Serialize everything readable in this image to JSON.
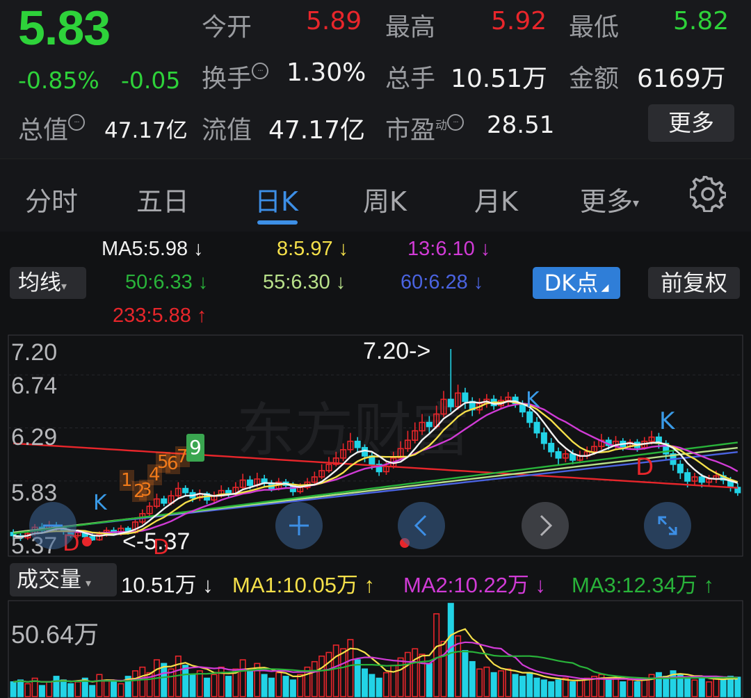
{
  "quote": {
    "price": "5.83",
    "change_pct": "-0.85%",
    "change_abs": "-0.05",
    "open_label": "今开",
    "open_value": "5.89",
    "high_label": "最高",
    "high_value": "5.92",
    "low_label": "最低",
    "low_value": "5.82",
    "turnover_label": "换手",
    "turnover_value": "1.30%",
    "volume_label": "总手",
    "volume_value": "10.51万",
    "amount_label": "金额",
    "amount_value": "6169万",
    "mktcap_label": "总值",
    "mktcap_value": "47.17亿",
    "float_label": "流值",
    "float_value": "47.17亿",
    "pe_label": "市盈",
    "pe_sup": "动",
    "pe_value": "28.51",
    "more_label": "更多",
    "colors": {
      "up": "#e8262b",
      "down": "#2ed23a"
    }
  },
  "tabs": {
    "items": [
      "分时",
      "五日",
      "日K",
      "周K",
      "月K",
      "更多"
    ],
    "active": "日K",
    "settings_icon": "gear-icon"
  },
  "kline_panel": {
    "ma_dropdown": "均线",
    "ma_values": [
      {
        "text": "MA5:5.98 ↓",
        "color": "#f2f2f2"
      },
      {
        "text": "8:5.97 ↓",
        "color": "#f5e04a"
      },
      {
        "text": "13:6.10 ↓",
        "color": "#d13bd6"
      },
      {
        "text": "50:6.33 ↓",
        "color": "#29b33a"
      },
      {
        "text": "55:6.30 ↓",
        "color": "#b8e08a"
      },
      {
        "text": "60:6.28 ↓",
        "color": "#4a63e0"
      },
      {
        "text": "233:5.88 ↑",
        "color": "#e8262b"
      }
    ],
    "dk_button": "DK点",
    "adjust_button": "前复权",
    "y_ticks": [
      "7.20",
      "6.74",
      "6.29",
      "5.83",
      "5.37"
    ],
    "max_label": "7.20->",
    "min_label": "<-5.37",
    "signal_k": "K",
    "signal_d": "D",
    "td_counts": [
      "1",
      "2",
      "3",
      "4",
      "5",
      "6",
      "7",
      "9"
    ],
    "watermark": "东方财富"
  },
  "volume_panel": {
    "dropdown": "成交量",
    "values": [
      {
        "text": "10.51万 ↓",
        "color": "#f2f2f2"
      },
      {
        "text": "MA1:10.05万 ↑",
        "color": "#f5e04a"
      },
      {
        "text": "MA2:10.22万 ↓",
        "color": "#d13bd6"
      },
      {
        "text": "MA3:12.34万 ↑",
        "color": "#29b33a"
      }
    ],
    "max_label": "50.64万"
  },
  "chart_data": {
    "type": "candlestick",
    "ylim": [
      5.37,
      7.2
    ],
    "candles": [
      [
        5.45,
        5.42,
        5.48,
        5.38
      ],
      [
        5.42,
        5.4,
        5.46,
        5.37
      ],
      [
        5.4,
        5.44,
        5.47,
        5.38
      ],
      [
        5.44,
        5.5,
        5.53,
        5.42
      ],
      [
        5.5,
        5.47,
        5.54,
        5.45
      ],
      [
        5.47,
        5.52,
        5.56,
        5.45
      ],
      [
        5.52,
        5.49,
        5.55,
        5.46
      ],
      [
        5.49,
        5.46,
        5.51,
        5.43
      ],
      [
        5.46,
        5.42,
        5.48,
        5.4
      ],
      [
        5.42,
        5.45,
        5.48,
        5.4
      ],
      [
        5.45,
        5.41,
        5.47,
        5.38
      ],
      [
        5.41,
        5.38,
        5.44,
        5.37
      ],
      [
        5.38,
        5.43,
        5.46,
        5.37
      ],
      [
        5.43,
        5.47,
        5.5,
        5.41
      ],
      [
        5.47,
        5.44,
        5.5,
        5.42
      ],
      [
        5.44,
        5.49,
        5.52,
        5.42
      ],
      [
        5.49,
        5.45,
        5.51,
        5.43
      ],
      [
        5.45,
        5.55,
        5.58,
        5.44
      ],
      [
        5.55,
        5.63,
        5.67,
        5.53
      ],
      [
        5.63,
        5.7,
        5.74,
        5.61
      ],
      [
        5.7,
        5.77,
        5.82,
        5.68
      ],
      [
        5.77,
        5.73,
        5.8,
        5.7
      ],
      [
        5.73,
        5.8,
        5.85,
        5.71
      ],
      [
        5.8,
        5.87,
        5.93,
        5.78
      ],
      [
        5.87,
        5.83,
        5.9,
        5.8
      ],
      [
        5.83,
        5.78,
        5.86,
        5.74
      ],
      [
        5.78,
        5.82,
        5.86,
        5.75
      ],
      [
        5.82,
        5.76,
        5.84,
        5.72
      ],
      [
        5.76,
        5.8,
        5.84,
        5.73
      ],
      [
        5.8,
        5.85,
        5.9,
        5.78
      ],
      [
        5.85,
        5.82,
        5.88,
        5.78
      ],
      [
        5.82,
        5.88,
        5.93,
        5.8
      ],
      [
        5.88,
        5.95,
        6.01,
        5.86
      ],
      [
        5.95,
        5.9,
        5.99,
        5.86
      ],
      [
        5.9,
        5.96,
        6.02,
        5.88
      ],
      [
        5.96,
        5.92,
        6.0,
        5.89
      ],
      [
        5.92,
        5.87,
        5.95,
        5.84
      ],
      [
        5.87,
        5.93,
        5.97,
        5.85
      ],
      [
        5.93,
        5.9,
        5.96,
        5.87
      ],
      [
        5.9,
        5.84,
        5.93,
        5.8
      ],
      [
        5.84,
        5.88,
        5.92,
        5.82
      ],
      [
        5.88,
        5.93,
        5.97,
        5.86
      ],
      [
        5.93,
        5.98,
        6.03,
        5.91
      ],
      [
        5.98,
        6.04,
        6.1,
        5.96
      ],
      [
        6.04,
        6.1,
        6.17,
        6.02
      ],
      [
        6.1,
        6.16,
        6.22,
        6.08
      ],
      [
        6.16,
        6.24,
        6.3,
        6.13
      ],
      [
        6.24,
        6.32,
        6.4,
        6.21
      ],
      [
        6.32,
        6.26,
        6.36,
        6.22
      ],
      [
        6.26,
        6.18,
        6.29,
        6.12
      ],
      [
        6.18,
        6.1,
        6.21,
        6.05
      ],
      [
        6.1,
        6.03,
        6.14,
        5.99
      ],
      [
        6.03,
        6.08,
        6.12,
        6.0
      ],
      [
        6.08,
        6.16,
        6.22,
        6.06
      ],
      [
        6.16,
        6.25,
        6.32,
        6.14
      ],
      [
        6.25,
        6.33,
        6.42,
        6.22
      ],
      [
        6.33,
        6.42,
        6.5,
        6.3
      ],
      [
        6.42,
        6.5,
        6.58,
        6.38
      ],
      [
        6.5,
        6.46,
        6.56,
        6.4
      ],
      [
        6.46,
        6.58,
        6.66,
        6.44
      ],
      [
        6.58,
        6.72,
        6.8,
        6.55
      ],
      [
        6.72,
        6.65,
        7.2,
        6.6
      ],
      [
        6.65,
        6.78,
        6.86,
        6.62
      ],
      [
        6.78,
        6.7,
        6.83,
        6.63
      ],
      [
        6.7,
        6.62,
        6.74,
        6.56
      ],
      [
        6.62,
        6.68,
        6.73,
        6.58
      ],
      [
        6.68,
        6.72,
        6.77,
        6.64
      ],
      [
        6.72,
        6.66,
        6.76,
        6.62
      ],
      [
        6.66,
        6.71,
        6.75,
        6.63
      ],
      [
        6.71,
        6.74,
        6.79,
        6.66
      ],
      [
        6.74,
        6.68,
        6.77,
        6.64
      ],
      [
        6.68,
        6.6,
        6.71,
        6.55
      ],
      [
        6.6,
        6.5,
        6.63,
        6.45
      ],
      [
        6.5,
        6.4,
        6.55,
        6.35
      ],
      [
        6.4,
        6.3,
        6.45,
        6.24
      ],
      [
        6.3,
        6.22,
        6.35,
        6.17
      ],
      [
        6.22,
        6.16,
        6.26,
        6.1
      ],
      [
        6.16,
        6.2,
        6.24,
        6.12
      ],
      [
        6.2,
        6.14,
        6.24,
        6.1
      ],
      [
        6.14,
        6.18,
        6.23,
        6.11
      ],
      [
        6.18,
        6.22,
        6.27,
        6.15
      ],
      [
        6.22,
        6.27,
        6.32,
        6.19
      ],
      [
        6.27,
        6.33,
        6.39,
        6.24
      ],
      [
        6.33,
        6.28,
        6.36,
        6.24
      ],
      [
        6.28,
        6.32,
        6.37,
        6.25
      ],
      [
        6.32,
        6.27,
        6.35,
        6.23
      ],
      [
        6.27,
        6.31,
        6.34,
        6.24
      ],
      [
        6.31,
        6.26,
        6.34,
        6.22
      ],
      [
        6.26,
        6.32,
        6.36,
        6.24
      ],
      [
        6.32,
        6.36,
        6.42,
        6.29
      ],
      [
        6.36,
        6.3,
        6.4,
        6.25
      ],
      [
        6.3,
        6.2,
        6.33,
        6.15
      ],
      [
        6.2,
        6.1,
        6.24,
        6.04
      ],
      [
        6.1,
        6.02,
        6.14,
        5.96
      ],
      [
        6.02,
        5.94,
        6.06,
        5.88
      ],
      [
        5.94,
        5.98,
        6.02,
        5.9
      ],
      [
        5.98,
        5.93,
        6.01,
        5.88
      ],
      [
        5.93,
        5.96,
        6.0,
        5.89
      ],
      [
        5.96,
        5.99,
        6.04,
        5.92
      ],
      [
        5.99,
        5.95,
        6.03,
        5.91
      ],
      [
        5.95,
        5.88,
        5.98,
        5.84
      ],
      [
        5.88,
        5.83,
        5.92,
        5.8
      ]
    ],
    "ma_lines": [
      {
        "name": "MA5",
        "color": "#f2f2f2"
      },
      {
        "name": "MA8",
        "color": "#f5e04a"
      },
      {
        "name": "MA13",
        "color": "#d13bd6"
      },
      {
        "name": "MA50",
        "color": "#29b33a"
      },
      {
        "name": "MA55",
        "color": "#b8e08a"
      },
      {
        "name": "MA60",
        "color": "#4a63e0"
      },
      {
        "name": "MA233",
        "color": "#e8262b"
      }
    ],
    "volume_max": 50.64,
    "volumes": [
      8,
      9,
      7,
      10,
      6,
      8,
      11,
      9,
      7,
      8,
      10,
      6,
      12,
      9,
      8,
      7,
      11,
      14,
      16,
      13,
      20,
      18,
      15,
      22,
      17,
      12,
      14,
      10,
      12,
      16,
      11,
      15,
      20,
      14,
      18,
      12,
      10,
      13,
      11,
      9,
      12,
      16,
      19,
      22,
      24,
      28,
      26,
      31,
      20,
      15,
      12,
      10,
      13,
      17,
      21,
      24,
      26,
      23,
      18,
      45,
      30,
      50.64,
      33,
      25,
      19,
      15,
      16,
      13,
      14,
      15,
      12,
      11,
      13,
      10,
      9,
      8,
      9,
      10,
      8,
      9,
      10,
      11,
      12,
      9,
      10,
      8,
      9,
      8,
      10,
      12,
      13,
      11,
      14,
      12,
      10,
      9,
      11,
      8,
      10,
      9,
      11,
      10.51
    ]
  }
}
